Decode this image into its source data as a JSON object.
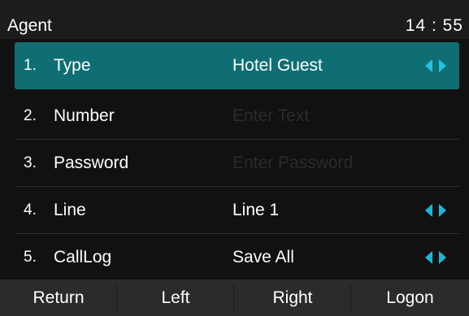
{
  "header": {
    "title": "Agent",
    "clock": "14 : 55"
  },
  "rows": [
    {
      "number": "1.",
      "label": "Type",
      "value": "Hotel Guest",
      "has_arrows": true,
      "selected": true
    },
    {
      "number": "2.",
      "label": "Number",
      "placeholder": "Enter Text",
      "has_arrows": false,
      "selected": false
    },
    {
      "number": "3.",
      "label": "Password",
      "placeholder": "Enter Password",
      "has_arrows": false,
      "selected": false
    },
    {
      "number": "4.",
      "label": "Line",
      "value": "Line 1",
      "has_arrows": true,
      "selected": false
    },
    {
      "number": "5.",
      "label": "CallLog",
      "value": "Save All",
      "has_arrows": true,
      "selected": false
    }
  ],
  "softkeys": {
    "return_label": "Return",
    "left_label": "Left",
    "right_label": "Right",
    "logon_label": "Logon"
  },
  "colors": {
    "selected_row": "#0e6e73",
    "arrow_accent": "#1db6d6",
    "softkey_bar": "#2b2b2b",
    "background": "#111111"
  }
}
